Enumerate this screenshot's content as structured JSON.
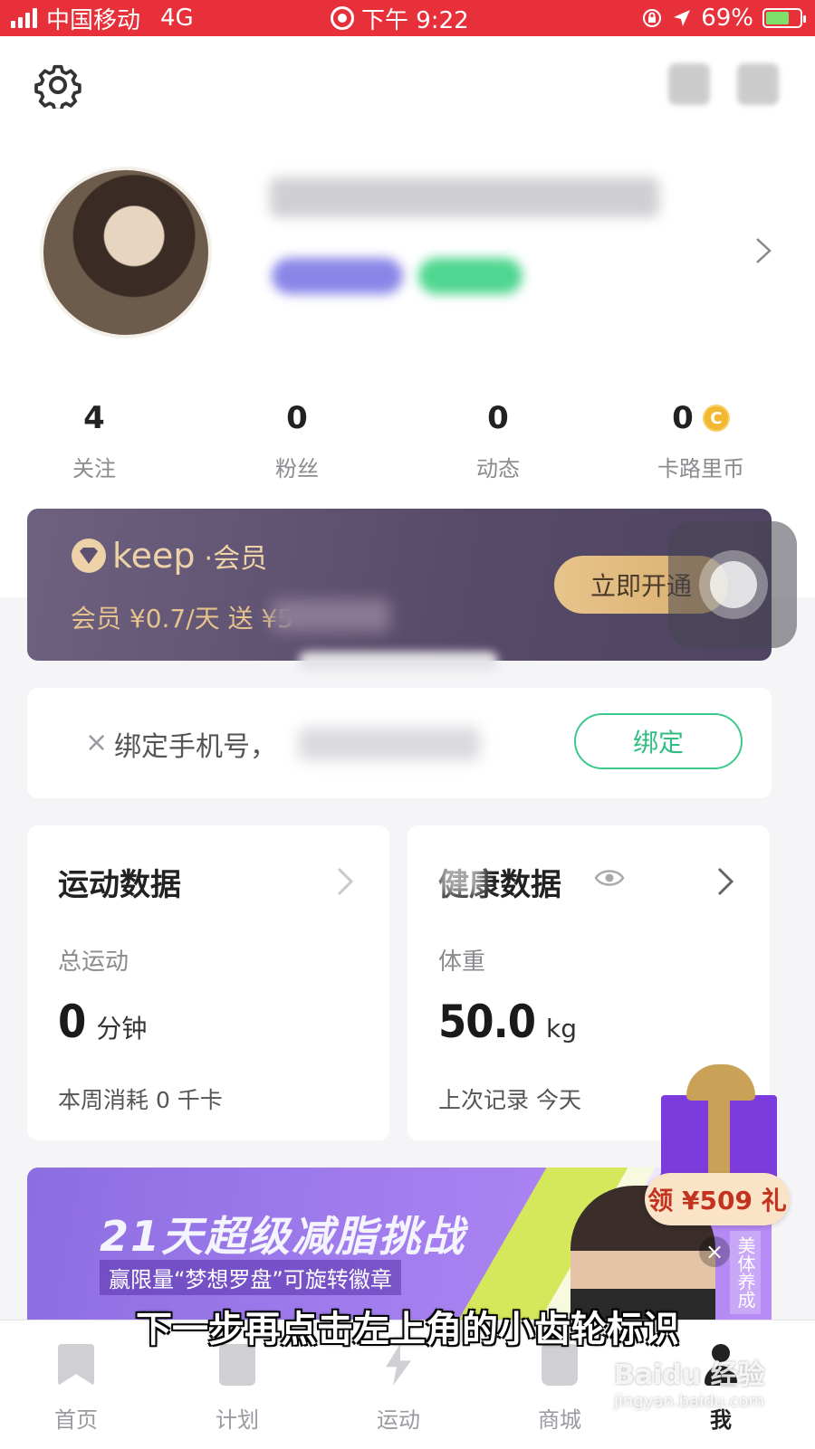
{
  "status_bar": {
    "carrier": "中国移动",
    "network": "4G",
    "time": "下午 9:22",
    "battery": "69%",
    "battery_level": 0.69
  },
  "header": {
    "settings_icon": "gear-icon"
  },
  "profile": {
    "stats": [
      {
        "value": "4",
        "label": "关注"
      },
      {
        "value": "0",
        "label": "粉丝"
      },
      {
        "value": "0",
        "label": "动态"
      },
      {
        "value": "0",
        "label": "卡路里币"
      }
    ]
  },
  "membership": {
    "logo_text": "keep",
    "logo_suffix": "·会员",
    "promo": "会员 ¥0.7/天 送 ¥5",
    "button": "立即开通",
    "accent": "#e6c38d"
  },
  "bind_phone": {
    "close": "×",
    "text": "绑定手机号，",
    "button": "绑定",
    "accent": "#3cc98b"
  },
  "sport_data": {
    "title": "运动数据",
    "subtitle": "总运动",
    "value": "0",
    "unit": "分钟",
    "footer": "本周消耗 0 千卡"
  },
  "health_data": {
    "title": "健康数据",
    "subtitle": "体重",
    "value": "50.0",
    "unit": "kg",
    "footer": "上次记录 今天"
  },
  "challenge_banner": {
    "headline": "21天超级减脂挑战",
    "subline": "赢限量“梦想罗盘”可旋转徽章",
    "side_text": "美体养成"
  },
  "gift": {
    "label": "领 ¥509 礼",
    "close": "×"
  },
  "caption": "下一步再点击左上角的小齿轮标识",
  "tabs": [
    {
      "label": "首页",
      "icon": "bookmark-icon"
    },
    {
      "label": "计划",
      "icon": "document-icon"
    },
    {
      "label": "运动",
      "icon": "bolt-icon"
    },
    {
      "label": "商城",
      "icon": "shopping-bag-icon"
    },
    {
      "label": "我",
      "icon": "person-icon",
      "active": true
    }
  ],
  "watermark": {
    "brand": "Baidu 经验",
    "url": "jingyan.baidu.com"
  }
}
